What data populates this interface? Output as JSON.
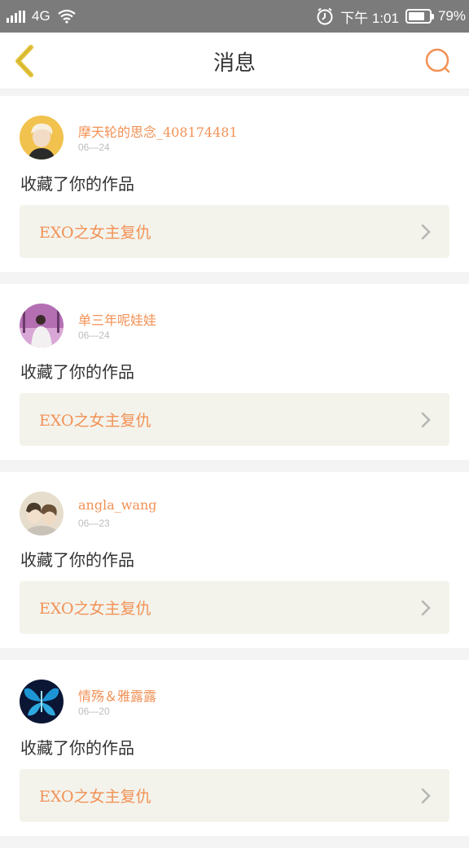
{
  "status_bar": {
    "network": "4G",
    "time": "下午 1:01",
    "battery": "79%",
    "battery_level": 0.79
  },
  "header": {
    "title": "消息",
    "back_icon": "chevron-left-icon",
    "search_icon": "search-icon"
  },
  "messages": [
    {
      "username": "摩天轮的思念_408174481",
      "date": "06—24",
      "action": "收藏了你的作品",
      "work_title": "EXO之女主复仇",
      "avatar_color": "#f1c24e"
    },
    {
      "username": "单三年呢娃娃",
      "date": "06—24",
      "action": "收藏了你的作品",
      "work_title": "EXO之女主复仇",
      "avatar_color": "#a45aa4"
    },
    {
      "username": "angla_wang",
      "date": "06—23",
      "action": "收藏了你的作品",
      "work_title": "EXO之女主复仇",
      "avatar_color": "#d9cbb5"
    },
    {
      "username": "情殇＆雅露露",
      "date": "06—20",
      "action": "收藏了你的作品",
      "work_title": "EXO之女主复仇",
      "avatar_color": "#0d1b3a"
    }
  ],
  "colors": {
    "accent": "#f29155",
    "back_icon": "#e4c33a",
    "card_link_bg": "#f3f3ec"
  }
}
